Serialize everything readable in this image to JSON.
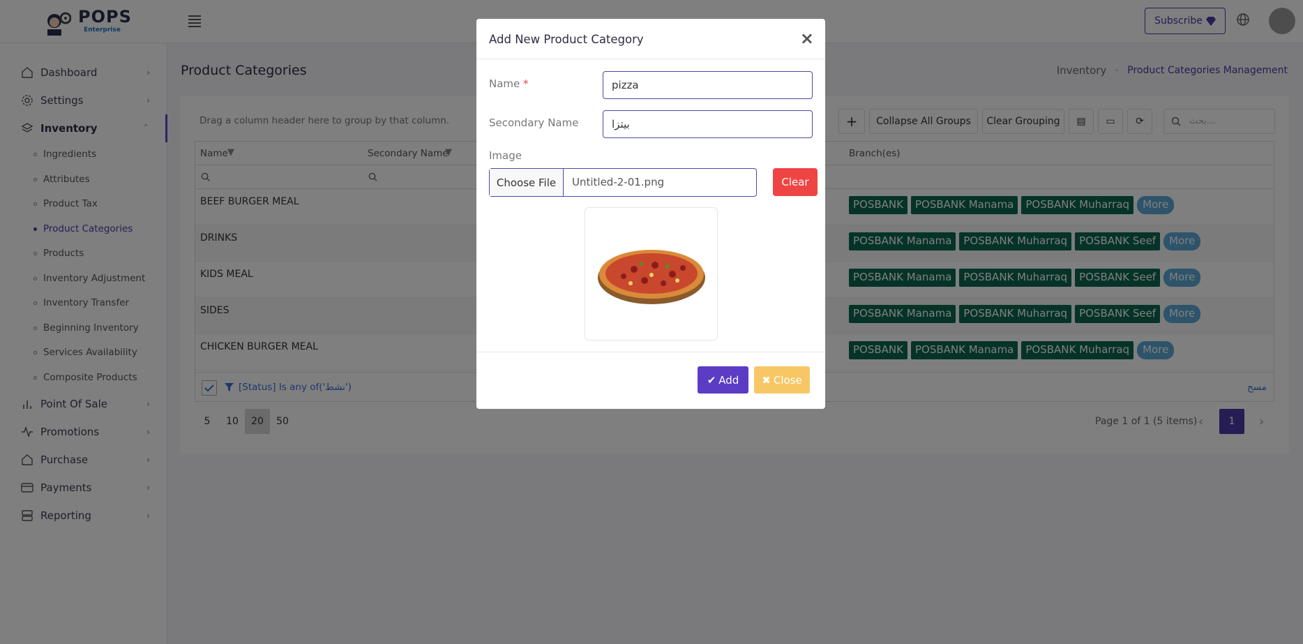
{
  "header": {
    "logo_text": "POPS",
    "logo_sub": "Enterprise",
    "subscribe_label": "Subscribe",
    "icons": [
      "menu-icon",
      "gem-icon",
      "globe-icon",
      "avatar"
    ]
  },
  "sidebar": {
    "items": [
      {
        "label": "Dashboard",
        "icon": "home-icon"
      },
      {
        "label": "Settings",
        "icon": "gear-icon"
      },
      {
        "label": "Inventory",
        "icon": "layers-icon",
        "active": true
      },
      {
        "label": "Point Of Sale",
        "icon": "bar-chart-icon"
      },
      {
        "label": "Promotions",
        "icon": "activity-icon"
      },
      {
        "label": "Purchase",
        "icon": "home-icon"
      },
      {
        "label": "Payments",
        "icon": "credit-card-icon"
      },
      {
        "label": "Reporting",
        "icon": "server-icon"
      }
    ],
    "inventory_sub": [
      "Ingredients",
      "Attributes",
      "Product Tax",
      "Product Categories",
      "Products",
      "Inventory Adjustment",
      "Inventory Transfer",
      "Beginning Inventory",
      "Services Availability",
      "Composite Products"
    ],
    "active_sub": "Product Categories"
  },
  "page": {
    "title": "Product Categories",
    "breadcrumb": [
      "Inventory",
      "Product Categories Management"
    ]
  },
  "grid": {
    "group_hint": "Drag a column header here to group by that column.",
    "toolbar": {
      "collapse_label": "Collapse All Groups",
      "clear_grouping_label": "Clear Grouping",
      "search_placeholder": "بحث..."
    },
    "columns": [
      "Name",
      "Secondary Name",
      "Branch(es)"
    ],
    "rows": [
      {
        "name": "BEEF BURGER MEAL",
        "branches": [
          "POSBANK",
          "POSBANK Manama",
          "POSBANK Muharraq"
        ]
      },
      {
        "name": "DRINKS",
        "branches": [
          "POSBANK Manama",
          "POSBANK Muharraq",
          "POSBANK Seef"
        ]
      },
      {
        "name": "KIDS MEAL",
        "branches": [
          "POSBANK Manama",
          "POSBANK Muharraq",
          "POSBANK Seef"
        ]
      },
      {
        "name": "SIDES",
        "branches": [
          "POSBANK Manama",
          "POSBANK Muharraq",
          "POSBANK Seef"
        ]
      },
      {
        "name": "CHICKEN BURGER MEAL",
        "branches": [
          "POSBANK",
          "POSBANK Manama",
          "POSBANK Muharraq"
        ]
      }
    ],
    "more_label": "More",
    "filter_text": "[Status] Is any of('نشط')",
    "clear_filter_label": "مسح",
    "page_sizes": [
      "5",
      "10",
      "20",
      "50"
    ],
    "selected_page_size": "20",
    "page_info": "Page 1 of 1 (5 items)",
    "current_page": "1"
  },
  "modal": {
    "title": "Add New Product Category",
    "name_label": "Name",
    "required_mark": "*",
    "name_value": "pizza",
    "secondary_label": "Secondary Name",
    "secondary_value": "بيتزا",
    "image_label": "Image",
    "choose_file_label": "Choose File",
    "file_name": "Untitled-2-01.png",
    "clear_label": "Clear",
    "add_label": "Add",
    "close_label": "Close"
  },
  "colors": {
    "accent": "#4a3aa6",
    "tag": "#0a6650",
    "more": "#5aa9d6",
    "danger": "#ef4444",
    "warning": "#f7c766"
  }
}
